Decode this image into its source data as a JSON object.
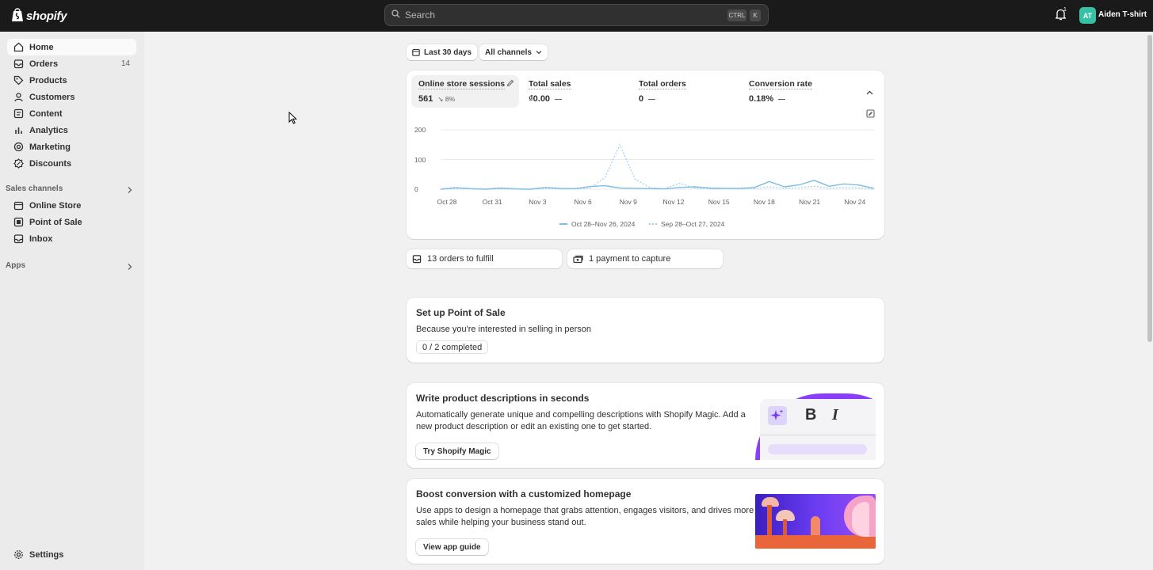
{
  "topbar": {
    "logo_text": "shopify",
    "search_placeholder": "Search",
    "shortcut_ctrl": "CTRL",
    "shortcut_k": "K",
    "notification_count": "1",
    "avatar_initials": "AT",
    "store_name": "Aiden T-shirt"
  },
  "sidebar": {
    "items": [
      {
        "label": "Home",
        "icon": "home-icon"
      },
      {
        "label": "Orders",
        "icon": "orders-icon",
        "count": "14"
      },
      {
        "label": "Products",
        "icon": "tag-icon"
      },
      {
        "label": "Customers",
        "icon": "person-icon"
      },
      {
        "label": "Content",
        "icon": "content-icon"
      },
      {
        "label": "Analytics",
        "icon": "chart-icon"
      },
      {
        "label": "Marketing",
        "icon": "target-icon"
      },
      {
        "label": "Discounts",
        "icon": "discount-icon"
      }
    ],
    "sales_channels_title": "Sales channels",
    "channels": [
      {
        "label": "Online Store",
        "icon": "store-icon"
      },
      {
        "label": "Point of Sale",
        "icon": "pos-icon"
      },
      {
        "label": "Inbox",
        "icon": "inbox-icon"
      }
    ],
    "apps_title": "Apps",
    "settings_label": "Settings"
  },
  "filters": {
    "date_range": "Last 30 days",
    "channels": "All channels"
  },
  "metrics": [
    {
      "title": "Online store sessions",
      "value": "561",
      "change": "8%"
    },
    {
      "title": "Total sales",
      "value": "₫0.00"
    },
    {
      "title": "Total orders",
      "value": "0"
    },
    {
      "title": "Conversion rate",
      "value": "0.18%"
    }
  ],
  "chart_data": {
    "type": "line",
    "yticks": [
      "200",
      "100",
      "0"
    ],
    "ylim": [
      0,
      200
    ],
    "xticks": [
      "Oct 28",
      "Oct 31",
      "Nov 3",
      "Nov 6",
      "Nov 9",
      "Nov 12",
      "Nov 15",
      "Nov 18",
      "Nov 21",
      "Nov 24"
    ],
    "series": [
      {
        "name": "Oct 28–Nov 26, 2024",
        "style": "solid",
        "color": "#7fbde6",
        "values": [
          0,
          5,
          2,
          0,
          4,
          1,
          0,
          6,
          3,
          2,
          9,
          12,
          4,
          3,
          2,
          1,
          6,
          8,
          4,
          3,
          3,
          6,
          26,
          8,
          15,
          30,
          10,
          18,
          14,
          3
        ]
      },
      {
        "name": "Sep 28–Oct 27, 2024",
        "style": "dashed",
        "color": "#9fcfee",
        "values": [
          0,
          2,
          1,
          0,
          1,
          0,
          0,
          2,
          1,
          1,
          3,
          40,
          150,
          35,
          5,
          2,
          20,
          3,
          1,
          2,
          1,
          2,
          8,
          3,
          5,
          10,
          3,
          6,
          4,
          1
        ]
      }
    ]
  },
  "tasks": {
    "orders_to_fulfill": "13 orders to fulfill",
    "payment_to_capture": "1 payment to capture"
  },
  "pos_setup": {
    "title": "Set up Point of Sale",
    "subtitle": "Because you're interested in selling in person",
    "progress": "0 / 2 completed"
  },
  "magic_card": {
    "title": "Write product descriptions in seconds",
    "line1": "Automatically generate unique and compelling descriptions with Shopify Magic. Add a",
    "line2": "new product description or edit an existing one to get started.",
    "button": "Try Shopify Magic",
    "bold_glyph": "B",
    "italic_glyph": "I"
  },
  "homepage_card": {
    "title": "Boost conversion with a customized homepage",
    "line1": "Use apps to design a homepage that grabs attention, engages visitors, and drives more",
    "line2": "sales while helping your business stand out.",
    "button": "View app guide"
  },
  "colors": {
    "topbar": "#1a1a1a",
    "accent_line": "#7fbde6",
    "magic_purple": "#8a3dff"
  }
}
